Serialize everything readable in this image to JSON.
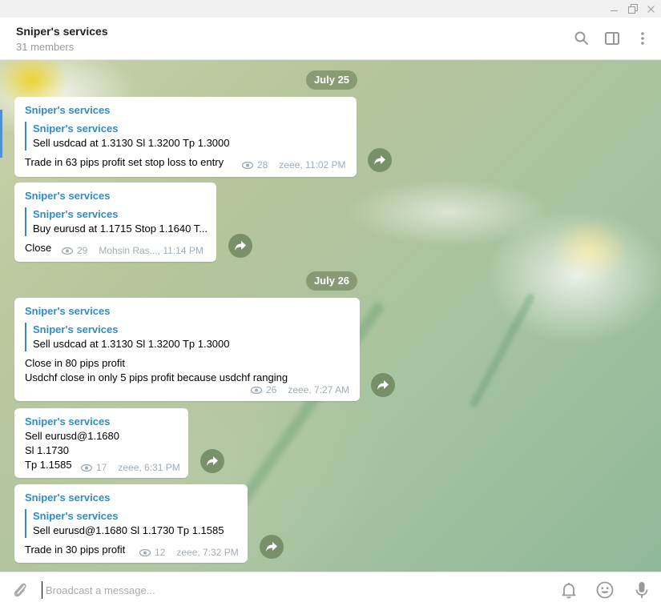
{
  "window": {
    "minimize_label": "",
    "maximize_label": "",
    "close_label": ""
  },
  "header": {
    "title": "Sniper's services",
    "subtitle": "31 members",
    "icons": [
      "search-icon",
      "sidebar-toggle-icon",
      "more-vert-icon"
    ]
  },
  "colors": {
    "accent": "#2f8cc8",
    "meta": "#a0acb6",
    "pill": "#7a8f66"
  },
  "messages": [
    {
      "date": "July 25",
      "sender": "Sniper's services",
      "reply_name": "Sniper's services",
      "reply_text": "Sell usdcad at 1.3130 Sl 1.3200 Tp 1.3000",
      "text": [
        "Trade in 63 pips profit set stop loss to entry"
      ],
      "views": "28",
      "author_time": "zeee, 11:02 PM"
    },
    {
      "sender": "Sniper's services",
      "reply_name": "Sniper's services",
      "reply_text": "Buy eurusd at 1.1715 Stop 1.1640 T...",
      "text": [
        "Close"
      ],
      "views": "29",
      "author_time": "Mohsin Ras..., 11:14 PM"
    },
    {
      "date": "July 26",
      "sender": "Sniper's services",
      "reply_name": "Sniper's services",
      "reply_text": "Sell usdcad at 1.3130 Sl 1.3200 Tp 1.3000",
      "text": [
        "Close in 80 pips profit",
        "Usdchf close in only 5 pips profit because usdchf ranging"
      ],
      "views": "26",
      "author_time": "zeee, 7:27 AM"
    },
    {
      "sender": "Sniper's services",
      "text": [
        "Sell eurusd@1.1680",
        "Sl 1.1730",
        "Tp 1.1585"
      ],
      "views": "17",
      "author_time": "zeee, 6:31 PM"
    },
    {
      "sender": "Sniper's services",
      "reply_name": "Sniper's services",
      "reply_text": "Sell eurusd@1.1680 Sl 1.1730 Tp 1.1585",
      "text": [
        "Trade in 30 pips profit"
      ],
      "views": "12",
      "author_time": "zeee, 7:32 PM"
    }
  ],
  "composer": {
    "placeholder": "Broadcast a message...",
    "value": "",
    "icons": [
      "attach-icon",
      "bell-icon",
      "emoji-icon",
      "microphone-icon"
    ]
  }
}
